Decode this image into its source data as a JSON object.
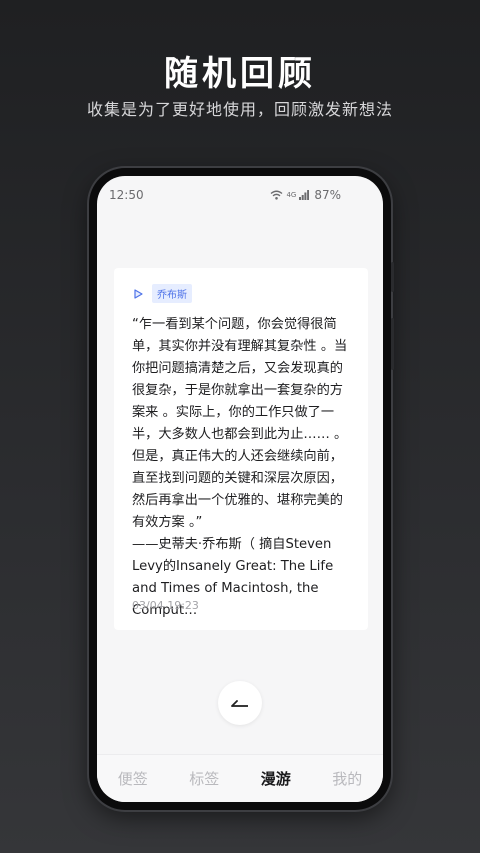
{
  "hero": {
    "title": "随机回顾",
    "subtitle": "收集是为了更好地使用，回顾激发新想法"
  },
  "status_bar": {
    "time": "12:50",
    "network": "4G",
    "battery": "87%"
  },
  "card": {
    "play_icon": "play-icon",
    "tag": "乔布斯",
    "quote": "“乍一看到某个问题，你会觉得很简单，其实你并没有理解其复杂性 。当你把问题搞清楚之后，又会发现真的很复杂，于是你就拿出一套复杂的方案来 。实际上，你的工作只做了一半，大多数人也都会到此为止…… 。但是，真正伟大的人还会继续向前，直至找到问题的关键和深层次原因，然后再拿出一个优雅的、堪称完美的有效方案 。”\n——史蒂夫·乔布斯（ 摘自Steven Levy的Insanely Great: The Life and Times of Macintosh, the Comput…",
    "timestamp": "03/04 19:23"
  },
  "back_button_icon": "back-arrow-icon",
  "tabs": [
    {
      "label": "便签",
      "active": false
    },
    {
      "label": "标签",
      "active": false
    },
    {
      "label": "漫游",
      "active": true
    },
    {
      "label": "我的",
      "active": false
    }
  ],
  "colors": {
    "accent": "#4f73e8",
    "tag_bg": "#e6edff",
    "background_top": "#1f2022",
    "background_bottom": "#353639"
  }
}
